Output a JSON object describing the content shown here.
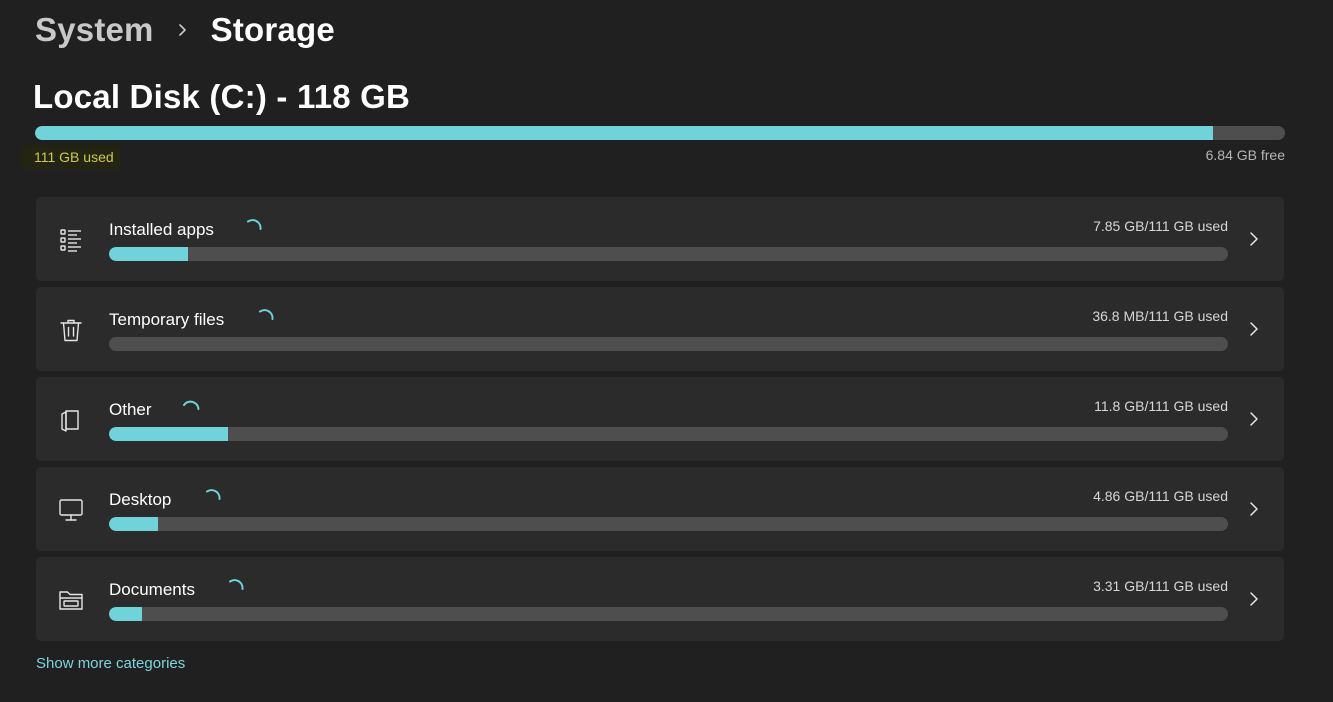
{
  "breadcrumb": {
    "parent": "System",
    "current": "Storage"
  },
  "disk": {
    "title": "Local Disk (C:) - 118 GB",
    "used_label": "111 GB used",
    "free_label": "6.84 GB free",
    "used_fraction": 0.942
  },
  "colors": {
    "accent": "#70d3da",
    "track": "#4e4e4e",
    "card": "#2b2b2b",
    "background": "#202020",
    "highlight_text": "#cfc84a"
  },
  "categories": [
    {
      "name": "Installed apps",
      "amount": "7.85 GB/111 GB used",
      "fraction": 0.0707,
      "icon": "list-icon"
    },
    {
      "name": "Temporary files",
      "amount": "36.8 MB/111 GB used",
      "fraction": 0.0,
      "icon": "trash-icon"
    },
    {
      "name": "Other",
      "amount": "11.8 GB/111 GB used",
      "fraction": 0.1063,
      "icon": "document-icon"
    },
    {
      "name": "Desktop",
      "amount": "4.86 GB/111 GB used",
      "fraction": 0.0438,
      "icon": "monitor-icon"
    },
    {
      "name": "Documents",
      "amount": "3.31 GB/111 GB used",
      "fraction": 0.0298,
      "icon": "folder-icon"
    }
  ],
  "show_more": "Show more categories"
}
